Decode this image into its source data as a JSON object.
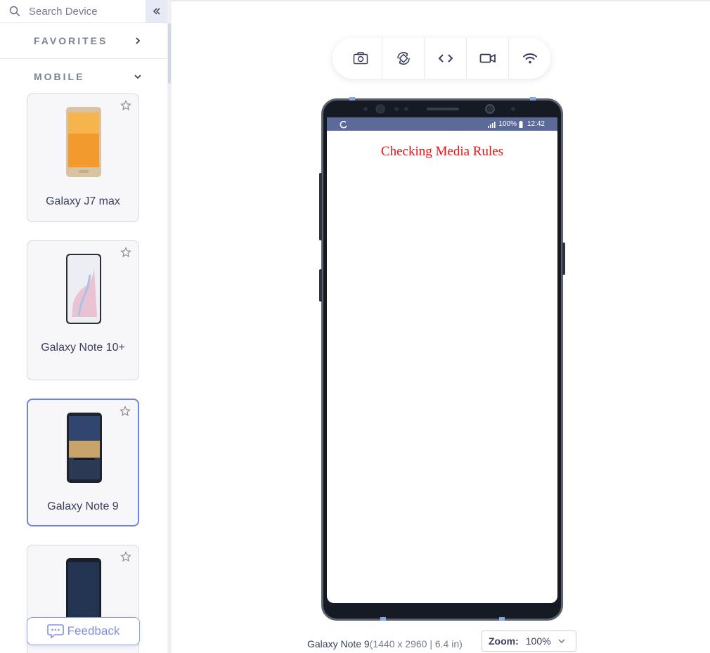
{
  "sidebar": {
    "search_placeholder": "Search Device",
    "favorites_label": "FAVORITES",
    "mobile_label": "MOBILE",
    "devices": [
      {
        "name": "Galaxy J7 max",
        "selected": false
      },
      {
        "name": "Galaxy Note 10+",
        "selected": false
      },
      {
        "name": "Galaxy Note 9",
        "selected": true
      },
      {
        "name": "",
        "selected": false
      }
    ],
    "feedback_label": "Feedback"
  },
  "toolbar": {
    "icons": [
      "camera-icon",
      "rotate-icon",
      "code-icon",
      "video-icon",
      "wifi-icon"
    ]
  },
  "phone": {
    "status": {
      "battery": "100%",
      "time": "12:42"
    },
    "page_heading": "Checking Media Rules"
  },
  "footer": {
    "device_name": "Galaxy Note 9",
    "device_dims": "(1440 x 2960 | 6.4 in)",
    "zoom_label": "Zoom:",
    "zoom_value": "100%"
  },
  "colors": {
    "accent": "#6f83e6",
    "status_bar": "#5c6a9a",
    "heading_red": "#ee1111"
  }
}
